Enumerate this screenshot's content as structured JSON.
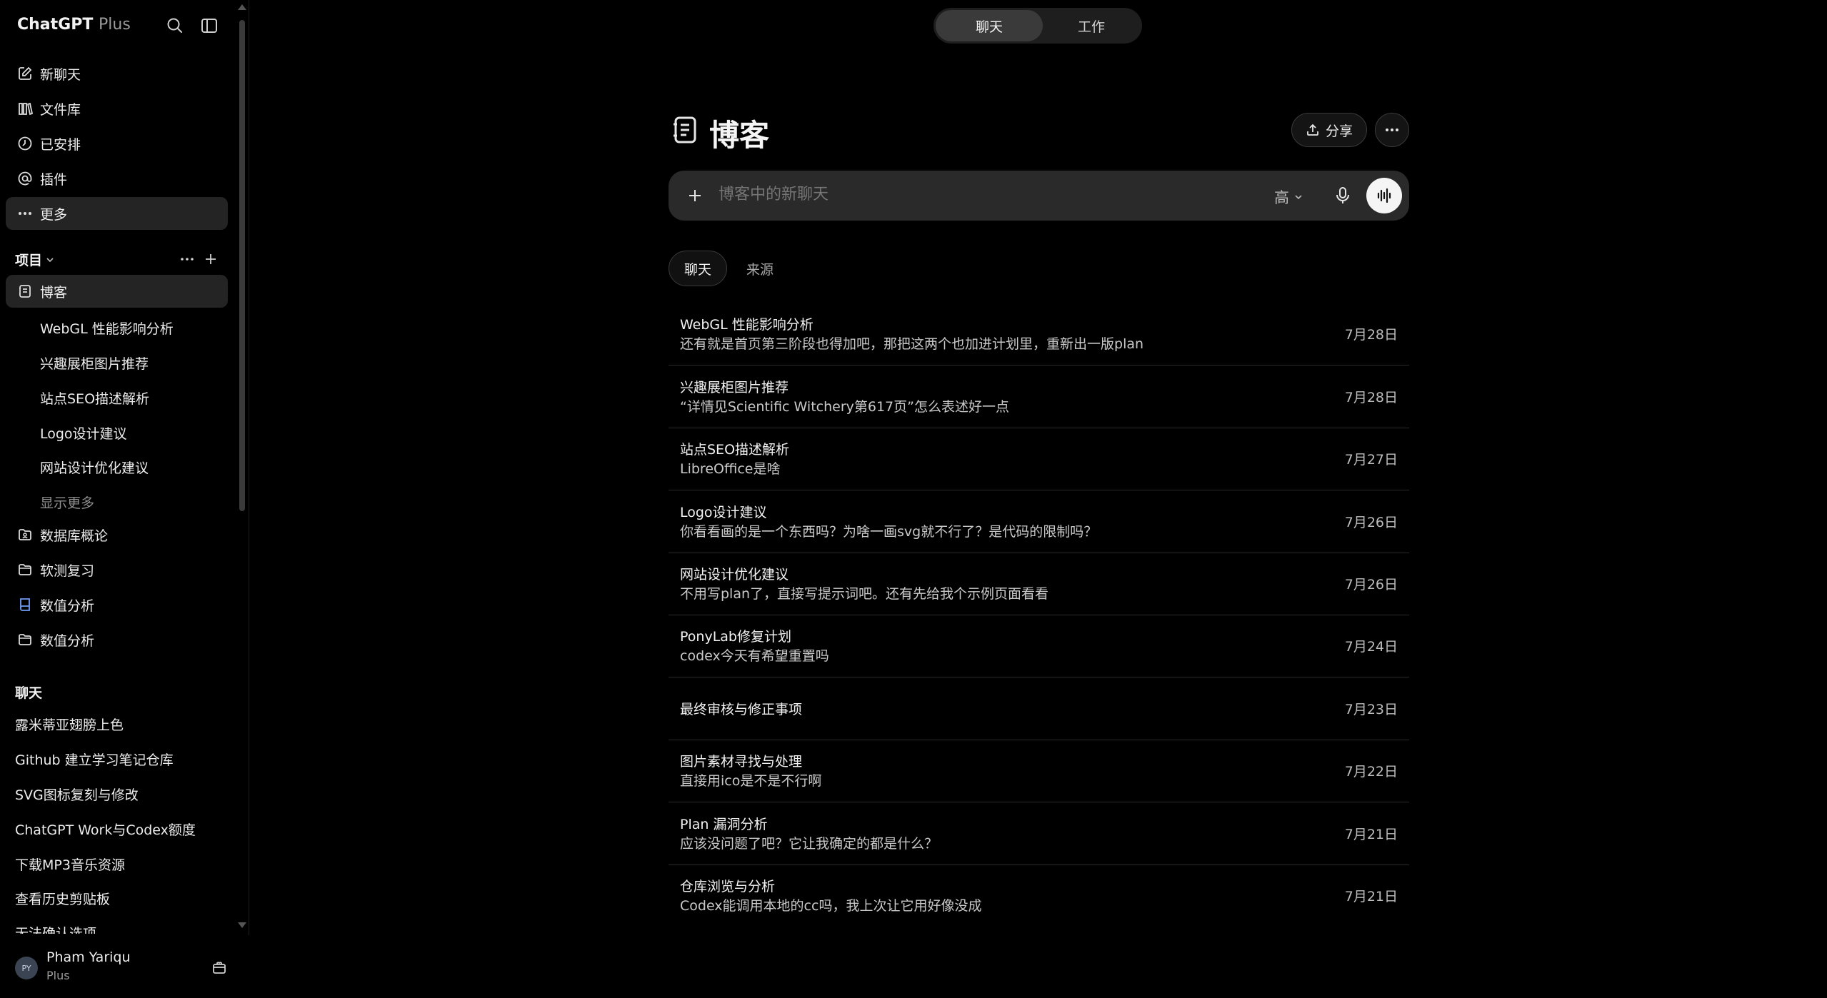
{
  "sidebar": {
    "brand": "ChatGPT",
    "brand_plan": "Plus",
    "nav": [
      {
        "label": "新聊天",
        "icon": "edit-icon"
      },
      {
        "label": "文件库",
        "icon": "library-icon"
      },
      {
        "label": "已安排",
        "icon": "clock-icon"
      },
      {
        "label": "插件",
        "icon": "at-icon"
      },
      {
        "label": "更多",
        "icon": "dots-icon"
      }
    ],
    "projects_title": "项目",
    "projects": [
      {
        "label": "博客",
        "icon": "notebook-icon"
      }
    ],
    "project_subitems": [
      "WebGL 性能影响分析",
      "兴趣展柜图片推荐",
      "站点SEO描述解析",
      "Logo设计建议",
      "网站设计优化建议"
    ],
    "show_more": "显示更多",
    "other_projects": [
      {
        "label": "数据库概论",
        "icon": "image-folder-icon"
      },
      {
        "label": "软测复习",
        "icon": "folder-icon"
      },
      {
        "label": "数值分析",
        "icon": "book-icon"
      },
      {
        "label": "数值分析",
        "icon": "folder-icon"
      }
    ],
    "chats_title": "聊天",
    "chats": [
      "露米蒂亚翅膀上色",
      "Github 建立学习笔记仓库",
      "SVG图标复刻与修改",
      "ChatGPT Work与Codex额度",
      "下载MP3音乐资源",
      "查看历史剪贴板",
      "无法确认选项"
    ],
    "user": {
      "initials": "PY",
      "name": "Pham Yariqu",
      "plan": "Plus"
    }
  },
  "topbar": {
    "tabs": [
      "聊天",
      "工作"
    ],
    "active": "聊天"
  },
  "project": {
    "title": "博客",
    "share_label": "分享",
    "composer": {
      "placeholder": "博客中的新聊天",
      "level": "高"
    },
    "tabs": [
      "聊天",
      "来源"
    ],
    "chats": [
      {
        "title": "WebGL 性能影响分析",
        "preview": "还有就是首页第三阶段也得加吧，那把这两个也加进计划里，重新出一版plan",
        "date": "7月28日"
      },
      {
        "title": "兴趣展柜图片推荐",
        "preview": "“详情见Scientific Witchery第617页”怎么表述好一点",
        "date": "7月28日"
      },
      {
        "title": "站点SEO描述解析",
        "preview": "LibreOffice是啥",
        "date": "7月27日"
      },
      {
        "title": "Logo设计建议",
        "preview": "你看看画的是一个东西吗？为啥一画svg就不行了？是代码的限制吗？",
        "date": "7月26日"
      },
      {
        "title": "网站设计优化建议",
        "preview": "不用写plan了，直接写提示词吧。还有先给我个示例页面看看",
        "date": "7月26日"
      },
      {
        "title": "PonyLab修复计划",
        "preview": "codex今天有希望重置吗",
        "date": "7月24日"
      },
      {
        "title": "最终审核与修正事项",
        "preview": "",
        "date": "7月23日"
      },
      {
        "title": "图片素材寻找与处理",
        "preview": "直接用ico是不是不行啊",
        "date": "7月22日"
      },
      {
        "title": "Plan 漏洞分析",
        "preview": "应该没问题了吧？它让我确定的都是什么？",
        "date": "7月21日"
      },
      {
        "title": "仓库浏览与分析",
        "preview": "Codex能调用本地的cc吗，我上次让它用好像没成",
        "date": "7月21日"
      }
    ]
  }
}
